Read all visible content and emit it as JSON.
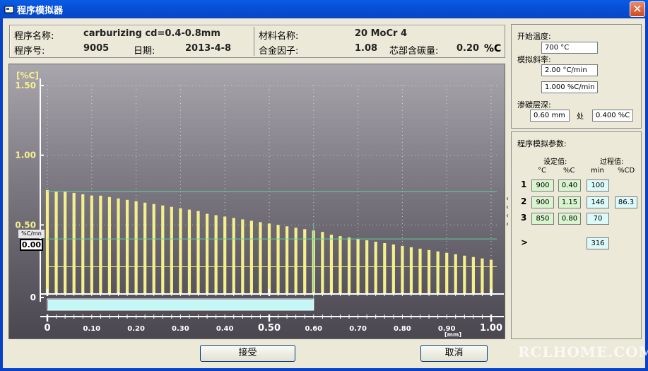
{
  "window": {
    "title": "程序模拟器",
    "close_glyph": "✕"
  },
  "info": {
    "program_name_label": "程序名称:",
    "program_name": "carburizing cd=0.4-0.8mm",
    "program_no_label": "程序号:",
    "program_no": "9005",
    "date_label": "日期:",
    "date": "2013-4-8",
    "material_label": "材料名称:",
    "material": "20 MoCr 4",
    "alloy_label": "合金因子:",
    "alloy": "1.08",
    "core_carbon_label": "芯部含碳量:",
    "core_carbon": "0.20",
    "core_carbon_unit": "%C"
  },
  "rate_box": {
    "label": "%C/mn",
    "value": "0.00"
  },
  "right": {
    "start_temp_label": "开始温度:",
    "start_temp": "700 °C",
    "slope_label": "模拟斜率:",
    "slope_temp": "2.00 °C/min",
    "slope_carbon": "1.000 %C/min",
    "depth_label": "渗碳层深:",
    "depth": "0.60 mm",
    "at_label": "处",
    "depth_carbon": "0.400 %C",
    "params_title": "程序模拟参数:",
    "set_label": "设定值:",
    "process_label": "过程值:",
    "col_c": "°C",
    "col_pc": "%C",
    "col_min": "min",
    "col_pcd": "%CD",
    "rows": [
      {
        "n": "1",
        "temp": "900",
        "pc": "0.40",
        "min": "100",
        "pcd": ""
      },
      {
        "n": "2",
        "temp": "900",
        "pc": "1.15",
        "min": "146",
        "pcd": "86.3"
      },
      {
        "n": "3",
        "temp": "850",
        "pc": "0.80",
        "min": "70",
        "pcd": ""
      }
    ],
    "total_label": ">",
    "total_min": "316"
  },
  "buttons": {
    "accept": "接受",
    "cancel": "取消"
  },
  "watermark": "RCLHOME.COM",
  "colors": {
    "bar": "#f5f08a",
    "accent_line": "#5ad29a",
    "progress": "#c6f7f7",
    "title_bar": "#0750d8"
  },
  "chart_data": {
    "type": "bar",
    "ylabel": "[%C]",
    "xlabel": "[mm]",
    "ylim": [
      0,
      1.5
    ],
    "xlim": [
      0,
      1.0
    ],
    "y_ticks": [
      "1.50",
      "1.00",
      "0.50",
      "0"
    ],
    "x_ticks": [
      "0",
      "0.10",
      "0.20",
      "0.30",
      "0.40",
      "0.50",
      "0.60",
      "0.70",
      "0.80",
      "0.90",
      "1.00"
    ],
    "x": [
      0.0,
      0.02,
      0.04,
      0.06,
      0.08,
      0.1,
      0.12,
      0.14,
      0.16,
      0.18,
      0.2,
      0.22,
      0.24,
      0.26,
      0.28,
      0.3,
      0.32,
      0.34,
      0.36,
      0.38,
      0.4,
      0.42,
      0.44,
      0.46,
      0.48,
      0.5,
      0.52,
      0.54,
      0.56,
      0.58,
      0.6,
      0.62,
      0.64,
      0.66,
      0.68,
      0.7,
      0.72,
      0.74,
      0.76,
      0.78,
      0.8,
      0.82,
      0.84,
      0.86,
      0.88,
      0.9,
      0.92,
      0.94,
      0.96,
      0.98,
      1.0
    ],
    "values": [
      0.75,
      0.74,
      0.74,
      0.73,
      0.72,
      0.71,
      0.71,
      0.7,
      0.69,
      0.68,
      0.67,
      0.66,
      0.65,
      0.64,
      0.63,
      0.62,
      0.61,
      0.6,
      0.58,
      0.57,
      0.56,
      0.55,
      0.54,
      0.53,
      0.52,
      0.51,
      0.5,
      0.49,
      0.48,
      0.47,
      0.46,
      0.45,
      0.43,
      0.42,
      0.41,
      0.4,
      0.39,
      0.38,
      0.37,
      0.36,
      0.35,
      0.34,
      0.33,
      0.32,
      0.31,
      0.3,
      0.29,
      0.28,
      0.27,
      0.26,
      0.25
    ],
    "reference_lines": {
      "upper": 0.74,
      "target": 0.4,
      "core": 0.2,
      "depth": 0.6
    },
    "progress": 0.6
  }
}
